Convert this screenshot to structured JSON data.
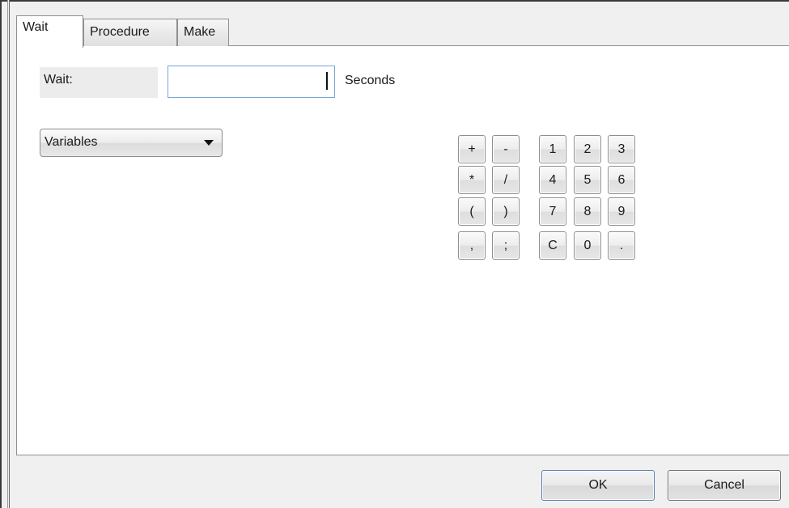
{
  "tabs": [
    {
      "label": "Wait",
      "active": true
    },
    {
      "label": "Procedure",
      "active": false
    },
    {
      "label": "Make",
      "active": false
    }
  ],
  "wait": {
    "label": "Wait:",
    "value": "",
    "unit_label": "Seconds"
  },
  "variables_select": {
    "selected": "Variables"
  },
  "keypad": {
    "operators": [
      "+",
      "-",
      "*",
      "/",
      "(",
      ")",
      ",",
      ";"
    ],
    "digits": [
      "1",
      "2",
      "3",
      "4",
      "5",
      "6",
      "7",
      "8",
      "9",
      "C",
      "0",
      "."
    ]
  },
  "buttons": {
    "ok": "OK",
    "cancel": "Cancel"
  }
}
